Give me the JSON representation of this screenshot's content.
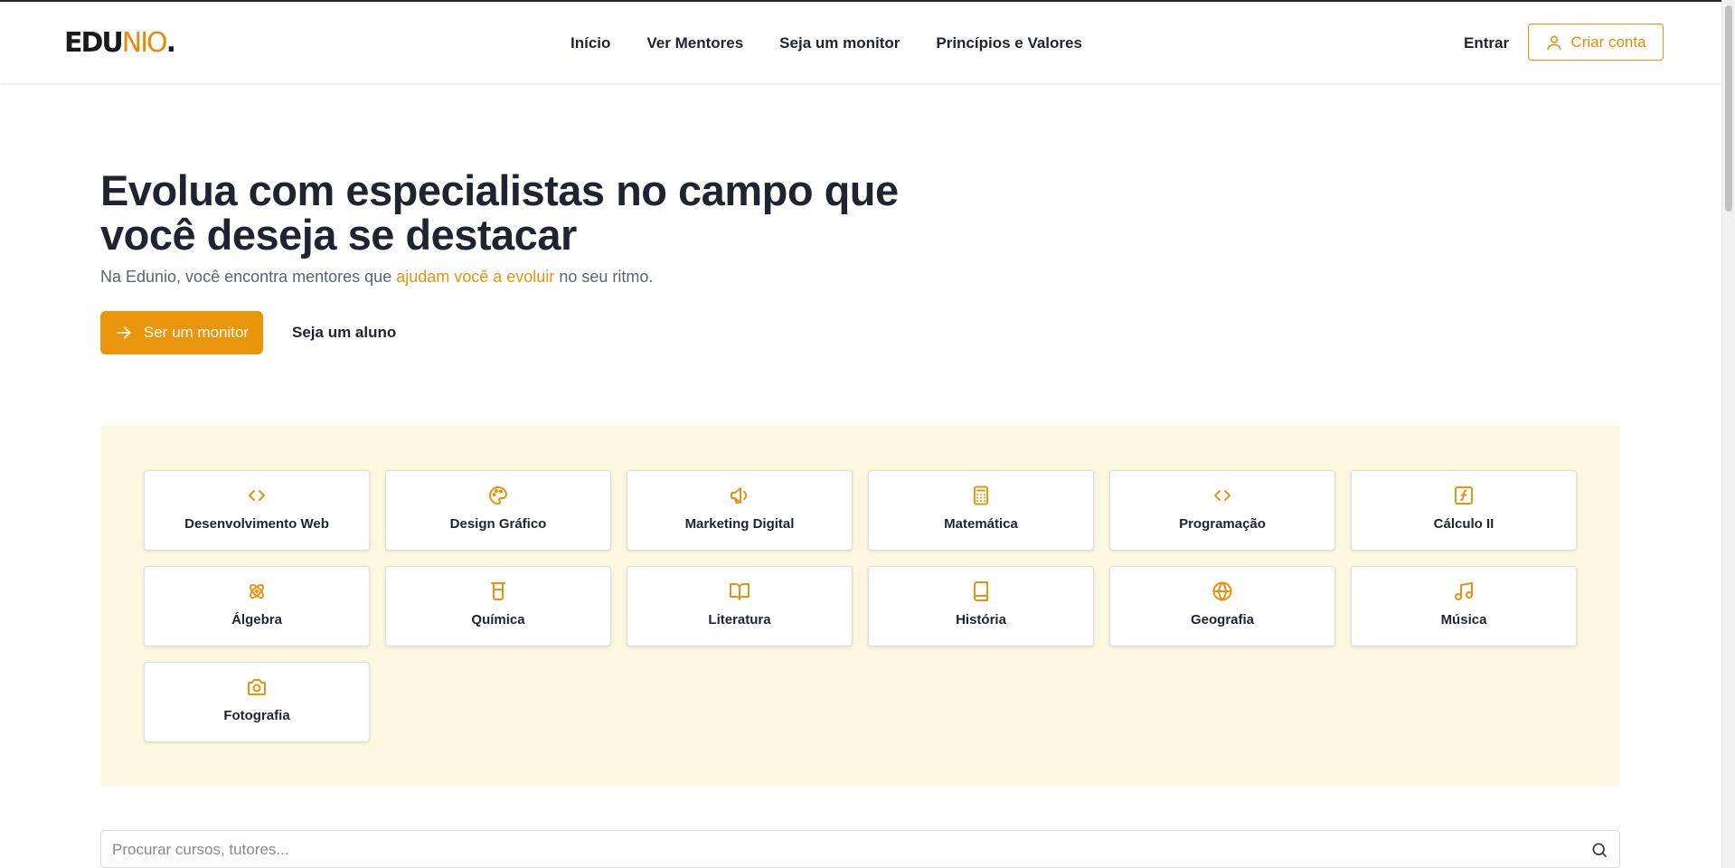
{
  "brand": {
    "logo_part1": "EDU",
    "logo_part2": "NIO",
    "logo_dot": ".",
    "accent": "#E8920F"
  },
  "nav": {
    "items": [
      "Início",
      "Ver Mentores",
      "Seja um monitor",
      "Princípios e Valores"
    ],
    "login": "Entrar",
    "signup": "Criar conta"
  },
  "hero": {
    "title": "Evolua com especialistas no campo que você deseja se destacar",
    "subtitle_before": "Na Edunio, você encontra mentores que ",
    "subtitle_highlight": "ajudam você a evoluir",
    "subtitle_after": " no seu ritmo.",
    "primary_cta": "Ser um monitor",
    "secondary_cta": "Seja um aluno"
  },
  "categories": [
    {
      "label": "Desenvolvimento Web",
      "icon": "code-icon"
    },
    {
      "label": "Design Gráfico",
      "icon": "palette-icon"
    },
    {
      "label": "Marketing Digital",
      "icon": "megaphone-icon"
    },
    {
      "label": "Matemática",
      "icon": "calculator-icon"
    },
    {
      "label": "Programação",
      "icon": "code-icon"
    },
    {
      "label": "Cálculo II",
      "icon": "function-icon"
    },
    {
      "label": "Álgebra",
      "icon": "atom-icon"
    },
    {
      "label": "Química",
      "icon": "beaker-icon"
    },
    {
      "label": "Literatura",
      "icon": "book-open-icon"
    },
    {
      "label": "História",
      "icon": "book-icon"
    },
    {
      "label": "Geografia",
      "icon": "globe-icon"
    },
    {
      "label": "Música",
      "icon": "music-icon"
    },
    {
      "label": "Fotografia",
      "icon": "camera-icon"
    }
  ],
  "search": {
    "placeholder": "Procurar cursos, tutores..."
  }
}
